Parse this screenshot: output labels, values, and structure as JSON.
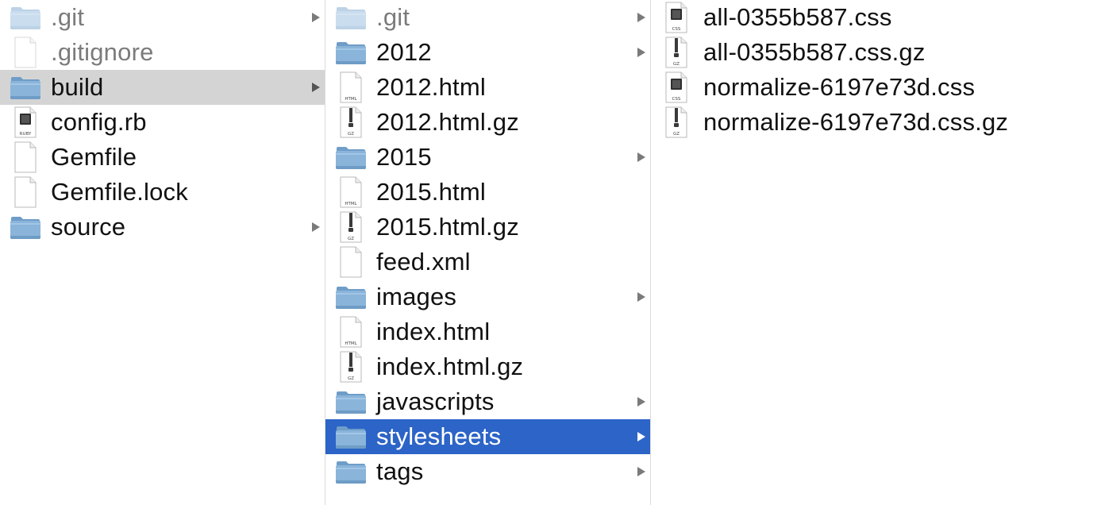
{
  "columns": [
    {
      "items": [
        {
          "name": ".git",
          "type": "folder",
          "hidden": true,
          "has_children": true,
          "selected": false
        },
        {
          "name": ".gitignore",
          "type": "file",
          "hidden": true,
          "has_children": false,
          "selected": false
        },
        {
          "name": "build",
          "type": "folder",
          "hidden": false,
          "has_children": true,
          "selected": "inactive"
        },
        {
          "name": "config.rb",
          "type": "ruby-file",
          "hidden": false,
          "has_children": false,
          "selected": false,
          "icon_label": "RUBY"
        },
        {
          "name": "Gemfile",
          "type": "file",
          "hidden": false,
          "has_children": false,
          "selected": false
        },
        {
          "name": "Gemfile.lock",
          "type": "file",
          "hidden": false,
          "has_children": false,
          "selected": false
        },
        {
          "name": "source",
          "type": "folder",
          "hidden": false,
          "has_children": true,
          "selected": false
        }
      ]
    },
    {
      "items": [
        {
          "name": ".git",
          "type": "folder",
          "hidden": true,
          "has_children": true,
          "selected": false
        },
        {
          "name": "2012",
          "type": "folder",
          "hidden": false,
          "has_children": true,
          "selected": false
        },
        {
          "name": "2012.html",
          "type": "html-file",
          "hidden": false,
          "has_children": false,
          "selected": false,
          "icon_label": "HTML"
        },
        {
          "name": "2012.html.gz",
          "type": "gz-file",
          "hidden": false,
          "has_children": false,
          "selected": false,
          "icon_label": "GZ"
        },
        {
          "name": "2015",
          "type": "folder",
          "hidden": false,
          "has_children": true,
          "selected": false
        },
        {
          "name": "2015.html",
          "type": "html-file",
          "hidden": false,
          "has_children": false,
          "selected": false,
          "icon_label": "HTML"
        },
        {
          "name": "2015.html.gz",
          "type": "gz-file",
          "hidden": false,
          "has_children": false,
          "selected": false,
          "icon_label": "GZ"
        },
        {
          "name": "feed.xml",
          "type": "file",
          "hidden": false,
          "has_children": false,
          "selected": false
        },
        {
          "name": "images",
          "type": "folder",
          "hidden": false,
          "has_children": true,
          "selected": false
        },
        {
          "name": "index.html",
          "type": "html-file",
          "hidden": false,
          "has_children": false,
          "selected": false,
          "icon_label": "HTML"
        },
        {
          "name": "index.html.gz",
          "type": "gz-file",
          "hidden": false,
          "has_children": false,
          "selected": false,
          "icon_label": "GZ"
        },
        {
          "name": "javascripts",
          "type": "folder",
          "hidden": false,
          "has_children": true,
          "selected": false
        },
        {
          "name": "stylesheets",
          "type": "folder",
          "hidden": false,
          "has_children": true,
          "selected": "active"
        },
        {
          "name": "tags",
          "type": "folder",
          "hidden": false,
          "has_children": true,
          "selected": false
        }
      ]
    },
    {
      "items": [
        {
          "name": "all-0355b587.css",
          "type": "css-file",
          "hidden": false,
          "has_children": false,
          "selected": false,
          "icon_label": "CSS"
        },
        {
          "name": "all-0355b587.css.gz",
          "type": "gz-file",
          "hidden": false,
          "has_children": false,
          "selected": false,
          "icon_label": "GZ"
        },
        {
          "name": "normalize-6197e73d.css",
          "type": "css-file",
          "hidden": false,
          "has_children": false,
          "selected": false,
          "icon_label": "CSS"
        },
        {
          "name": "normalize-6197e73d.css.gz",
          "type": "gz-file",
          "hidden": false,
          "has_children": false,
          "selected": false,
          "icon_label": "GZ"
        }
      ]
    }
  ],
  "colors": {
    "selection_active": "#2c64c7",
    "selection_inactive": "#d4d4d4",
    "folder_blue": "#7fa9d2",
    "folder_dark": "#5b8ab9",
    "hidden_text": "#7b7b7b"
  }
}
